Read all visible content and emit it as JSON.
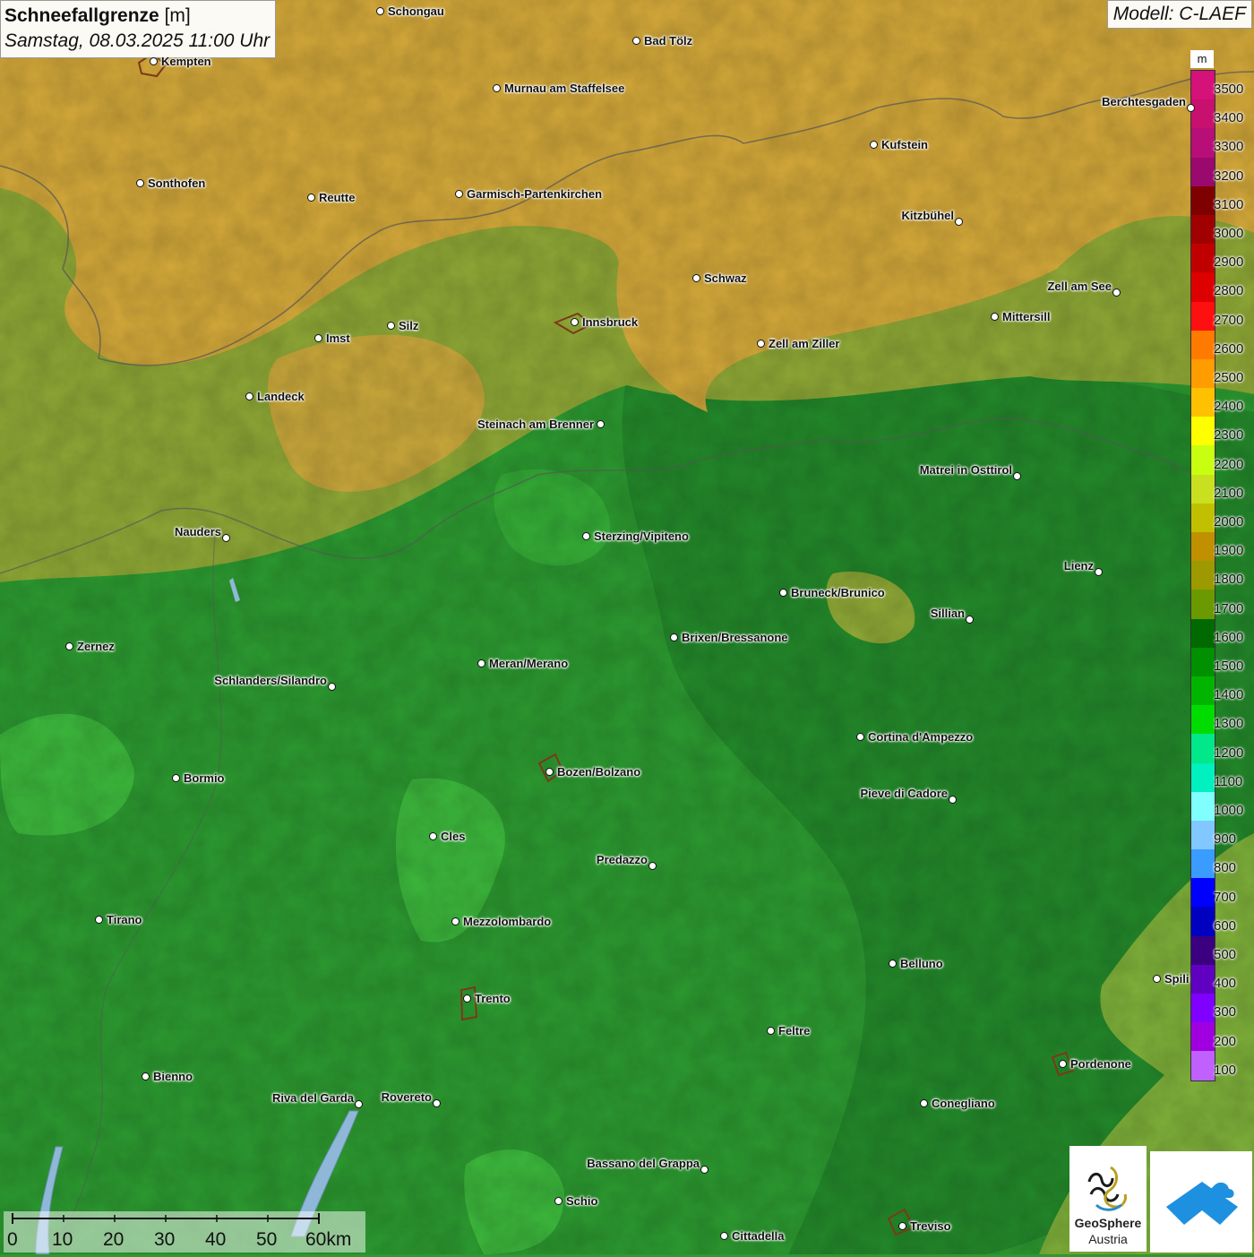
{
  "title": {
    "parameter": "Schneefallgrenze",
    "unit": "[m]",
    "datetime": "Samstag, 08.03.2025 11:00 Uhr"
  },
  "model": "Modell: C-LAEF",
  "legend": {
    "unit": "m",
    "levels": [
      "3500",
      "3400",
      "3300",
      "3200",
      "3100",
      "3000",
      "2900",
      "2800",
      "2700",
      "2600",
      "2500",
      "2400",
      "2300",
      "2200",
      "2100",
      "2000",
      "1900",
      "1800",
      "1700",
      "1600",
      "1500",
      "1400",
      "1300",
      "1200",
      "1100",
      "1000",
      "900",
      "800",
      "700",
      "600",
      "500",
      "400",
      "300",
      "200",
      "100"
    ],
    "colors": [
      "#d5117a",
      "#c8106e",
      "#b80e78",
      "#9a0a6e",
      "#7f0000",
      "#a00000",
      "#c00000",
      "#dd0000",
      "#ff1010",
      "#ff7a00",
      "#ff9c00",
      "#ffc000",
      "#ffff00",
      "#c8ff10",
      "#c8e020",
      "#c0c000",
      "#c09000",
      "#9c9a00",
      "#6a9a00",
      "#006a00",
      "#009000",
      "#00b400",
      "#00dc00",
      "#00e88a",
      "#00f0c0",
      "#80ffff",
      "#80c8ff",
      "#3a9cff",
      "#0000ff",
      "#0000c0",
      "#3a0080",
      "#6000c0",
      "#8000ff",
      "#a000e0",
      "#c060ff"
    ]
  },
  "cities": [
    {
      "name": "Schongau"
    },
    {
      "name": "Kempten"
    },
    {
      "name": "Bad Tölz"
    },
    {
      "name": "Murnau am Staffelsee"
    },
    {
      "name": "Berchtesgaden"
    },
    {
      "name": "Kufstein"
    },
    {
      "name": "Sonthofen"
    },
    {
      "name": "Reutte"
    },
    {
      "name": "Garmisch-Partenkirchen"
    },
    {
      "name": "Kitzbühel"
    },
    {
      "name": "Schwaz"
    },
    {
      "name": "Zell am See"
    },
    {
      "name": "Innsbruck"
    },
    {
      "name": "Mittersill"
    },
    {
      "name": "Imst"
    },
    {
      "name": "Silz"
    },
    {
      "name": "Zell am Ziller"
    },
    {
      "name": "Landeck"
    },
    {
      "name": "Steinach am Brenner"
    },
    {
      "name": "Matrei in Osttirol"
    },
    {
      "name": "Nauders"
    },
    {
      "name": "Sterzing/Vipiteno"
    },
    {
      "name": "Lienz"
    },
    {
      "name": "Bruneck/Brunico"
    },
    {
      "name": "Sillian"
    },
    {
      "name": "Zernez"
    },
    {
      "name": "Brixen/Bressanone"
    },
    {
      "name": "Meran/Merano"
    },
    {
      "name": "Schlanders/Silandro"
    },
    {
      "name": "Cortina d'Ampezzo"
    },
    {
      "name": "Bozen/Bolzano"
    },
    {
      "name": "Bormio"
    },
    {
      "name": "Pieve di Cadore"
    },
    {
      "name": "Cles"
    },
    {
      "name": "Predazzo"
    },
    {
      "name": "Tirano"
    },
    {
      "name": "Mezzolombardo"
    },
    {
      "name": "Belluno"
    },
    {
      "name": "Spili"
    },
    {
      "name": "Trento"
    },
    {
      "name": "Feltre"
    },
    {
      "name": "Pordenone"
    },
    {
      "name": "Bienno"
    },
    {
      "name": "Riva del Garda"
    },
    {
      "name": "Rovereto"
    },
    {
      "name": "Conegliano"
    },
    {
      "name": "Bassano del Grappa"
    },
    {
      "name": "Schio"
    },
    {
      "name": "Treviso"
    },
    {
      "name": "Cittadella"
    }
  ],
  "scale": {
    "ticks": [
      "0",
      "10",
      "20",
      "30",
      "40",
      "50",
      "60km"
    ]
  },
  "logo": {
    "line1": "GeoSphere",
    "line2": "Austria"
  },
  "field_colors": {
    "orange": "#d4a93a",
    "olive": "#8fa836",
    "green": "#2c9a30",
    "light_green": "#3cb83c",
    "dark_green": "#238a2a"
  }
}
